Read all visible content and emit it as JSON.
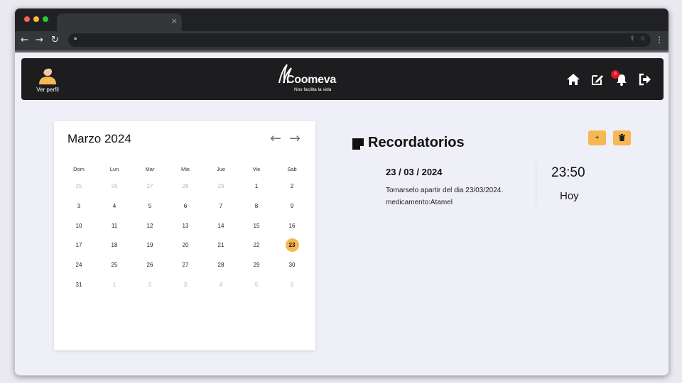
{
  "browser": {
    "tab_close": "×",
    "url": ""
  },
  "header": {
    "profile_label": "Ver perfil",
    "logo_name": "Coomeva",
    "logo_tagline": "Nos facilita la vida",
    "notification_count": "0"
  },
  "calendar": {
    "title": "Marzo 2024",
    "weekdays": [
      "Dom",
      "Lun",
      "Mar",
      "Mie",
      "Jue",
      "Vie",
      "Sab"
    ],
    "weeks": [
      [
        {
          "d": "25",
          "m": true
        },
        {
          "d": "26",
          "m": true
        },
        {
          "d": "27",
          "m": true
        },
        {
          "d": "28",
          "m": true
        },
        {
          "d": "29",
          "m": true
        },
        {
          "d": "1"
        },
        {
          "d": "2"
        }
      ],
      [
        {
          "d": "3"
        },
        {
          "d": "4"
        },
        {
          "d": "5"
        },
        {
          "d": "6"
        },
        {
          "d": "7"
        },
        {
          "d": "8"
        },
        {
          "d": "9"
        }
      ],
      [
        {
          "d": "10"
        },
        {
          "d": "11"
        },
        {
          "d": "12"
        },
        {
          "d": "13"
        },
        {
          "d": "14"
        },
        {
          "d": "15"
        },
        {
          "d": "16"
        }
      ],
      [
        {
          "d": "17"
        },
        {
          "d": "18"
        },
        {
          "d": "19"
        },
        {
          "d": "20"
        },
        {
          "d": "21"
        },
        {
          "d": "22"
        },
        {
          "d": "23",
          "today": true
        }
      ],
      [
        {
          "d": "24"
        },
        {
          "d": "25"
        },
        {
          "d": "26"
        },
        {
          "d": "27"
        },
        {
          "d": "28"
        },
        {
          "d": "29"
        },
        {
          "d": "30"
        }
      ],
      [
        {
          "d": "31"
        },
        {
          "d": "1",
          "m": true
        },
        {
          "d": "2",
          "m": true
        },
        {
          "d": "3",
          "m": true
        },
        {
          "d": "4",
          "m": true
        },
        {
          "d": "5",
          "m": true
        },
        {
          "d": "6",
          "m": true
        }
      ]
    ]
  },
  "reminders": {
    "title": "Recordatorios",
    "add_label": "+",
    "items": [
      {
        "date": "23 / 03 / 2024",
        "description": "Tomarselo apartir del dia 23/03/2024. medicamento:Atamel",
        "time": "23:50",
        "day": "Hoy"
      }
    ]
  },
  "colors": {
    "accent": "#f7b752",
    "navbar": "#1d1d1f",
    "badge": "#e0161b"
  }
}
